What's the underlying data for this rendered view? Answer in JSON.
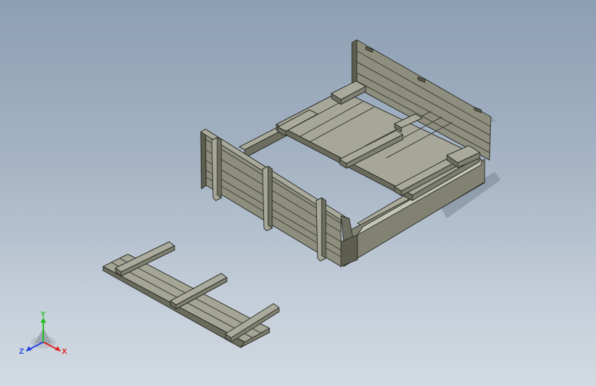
{
  "model": {
    "name": "sandbox-with-bench-lids",
    "colors": {
      "background_top": "#8d9fb4",
      "background_bottom": "#d2dae2",
      "face_light": "#a7a899",
      "face_mid": "#8d8e7d",
      "face_dark": "#5d5e50",
      "edge": "#2b2b25"
    }
  },
  "triad": {
    "x_label": "X",
    "y_label": "Y",
    "z_label": "Z",
    "x_color": "#e02020",
    "y_color": "#20c020",
    "z_color": "#2040e0"
  }
}
